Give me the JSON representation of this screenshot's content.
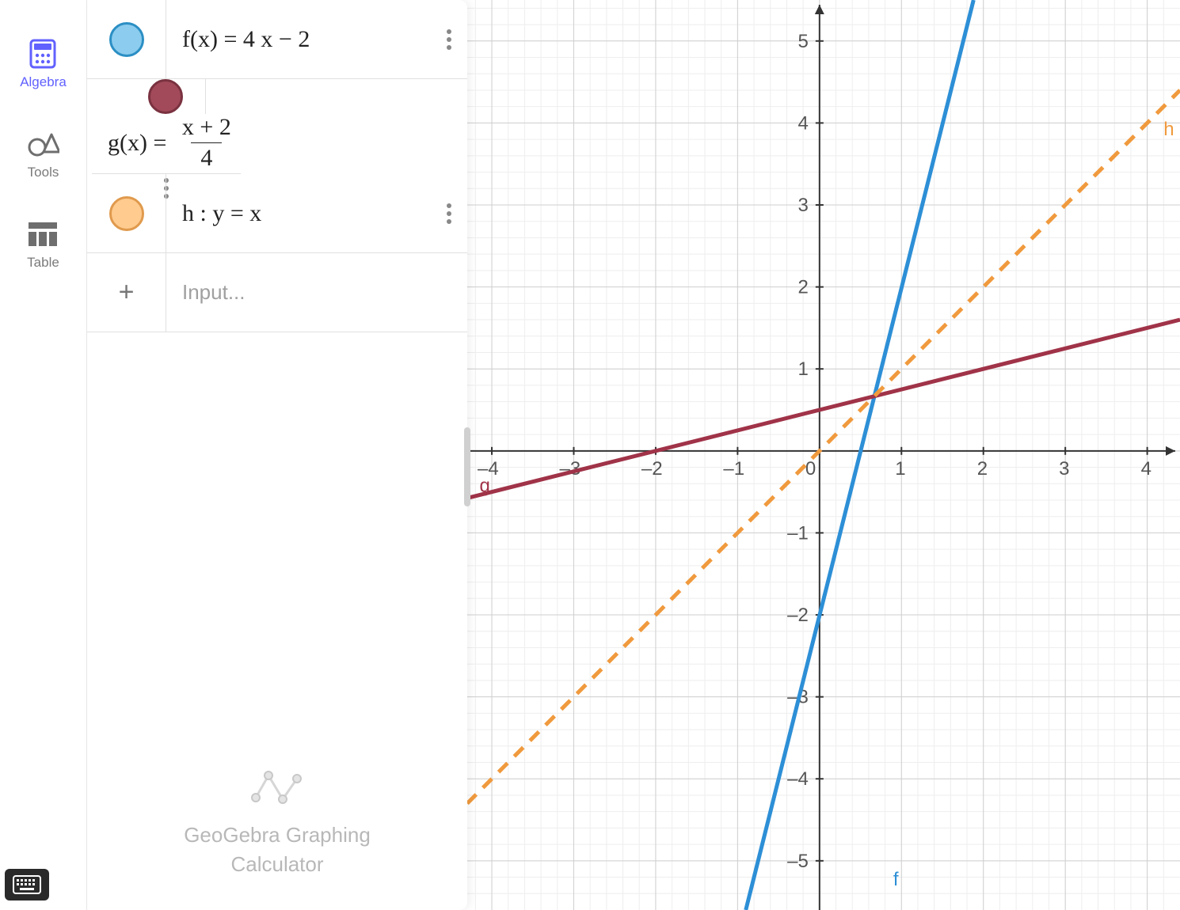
{
  "leftnav": {
    "items": [
      {
        "id": "algebra",
        "label": "Algebra",
        "active": true
      },
      {
        "id": "tools",
        "label": "Tools",
        "active": false
      },
      {
        "id": "table",
        "label": "Table",
        "active": false
      }
    ]
  },
  "expressions": [
    {
      "name": "f",
      "display_lhs": "f(x)",
      "display_rhs": "4 x − 2",
      "color_fill": "#8cccee",
      "color_border": "#2b8fc4",
      "type": "plain"
    },
    {
      "name": "g",
      "display_lhs": "g(x)",
      "display_rhs_num": "x + 2",
      "display_rhs_den": "4",
      "color_fill": "#a24a5a",
      "color_border": "#7a3240",
      "type": "fraction"
    },
    {
      "name": "h",
      "display_full": "h : y = x",
      "color_fill": "#ffcb8f",
      "color_border": "#e09a4d",
      "type": "plain2"
    }
  ],
  "input_placeholder": "Input...",
  "footer": {
    "line1": "GeoGebra Graphing",
    "line2": "Calculator"
  },
  "chart_data": {
    "type": "line",
    "title": "",
    "xlabel": "",
    "ylabel": "",
    "xlim": [
      -4.3,
      4.4
    ],
    "ylim": [
      -5.6,
      5.5
    ],
    "x_ticks": [
      -4,
      -3,
      -2,
      -1,
      0,
      1,
      2,
      3,
      4
    ],
    "y_ticks": [
      -5,
      -4,
      -3,
      -2,
      -1,
      1,
      2,
      3,
      4,
      5
    ],
    "grid": {
      "major": 1,
      "minor": 0.2
    },
    "series": [
      {
        "name": "f",
        "label": "f",
        "color": "#2d8fd6",
        "style": "solid",
        "width": 5,
        "equation": "y = 4x - 2",
        "points": [
          [
            -0.9,
            -5.6
          ],
          [
            1.88,
            5.5
          ]
        ]
      },
      {
        "name": "g",
        "label": "g",
        "color": "#a03348",
        "style": "solid",
        "width": 5,
        "equation": "y = (x + 2) / 4",
        "points": [
          [
            -4.3,
            -0.575
          ],
          [
            4.4,
            1.6
          ]
        ]
      },
      {
        "name": "h",
        "label": "h",
        "color": "#f09a3e",
        "style": "dashed",
        "width": 5,
        "equation": "y = x",
        "points": [
          [
            -4.3,
            -4.3
          ],
          [
            4.4,
            4.4
          ]
        ]
      }
    ],
    "intersections": [
      {
        "of": [
          "f",
          "g",
          "h"
        ],
        "x": 0.6667,
        "y": 0.6667
      }
    ],
    "curve_labels": [
      {
        "name": "f",
        "x": 0.9,
        "y": -5.3,
        "color": "#2d8fd6"
      },
      {
        "name": "g",
        "x": -4.15,
        "y": -0.5,
        "color": "#a03348"
      },
      {
        "name": "h",
        "x": 4.2,
        "y": 3.85,
        "color": "#f09a3e"
      }
    ]
  }
}
